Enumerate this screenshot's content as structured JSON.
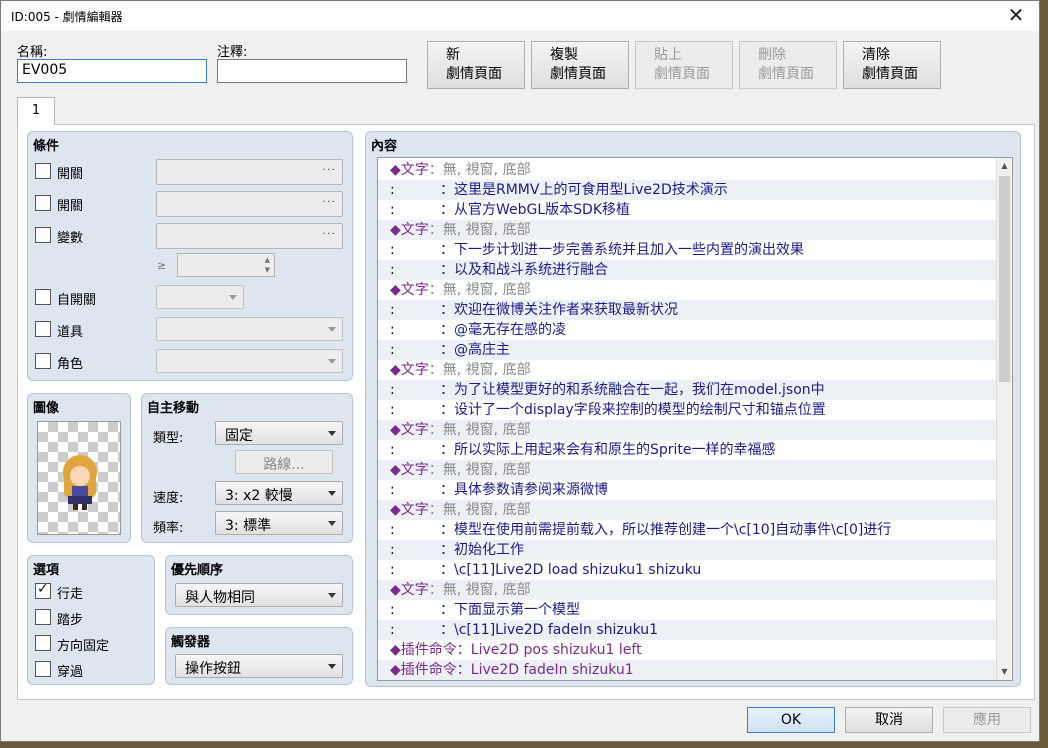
{
  "window": {
    "title": "ID:005 - 劇情編輯器"
  },
  "header": {
    "name_label": "名稱:",
    "name_value": "EV005",
    "note_label": "注釋:",
    "note_value": ""
  },
  "pagebuttons": [
    {
      "line1": "新",
      "line2": "劇情頁面",
      "disabled": false
    },
    {
      "line1": "複製",
      "line2": "劇情頁面",
      "disabled": false
    },
    {
      "line1": "貼上",
      "line2": "劇情頁面",
      "disabled": true
    },
    {
      "line1": "刪除",
      "line2": "劇情頁面",
      "disabled": true
    },
    {
      "line1": "清除",
      "line2": "劇情頁面",
      "disabled": false
    }
  ],
  "tab": {
    "label": "1"
  },
  "conditions": {
    "title": "條件",
    "switch1": "開關",
    "switch2": "開關",
    "variable": "變數",
    "ge": "≥",
    "self_switch": "自開關",
    "item": "道具",
    "actor": "角色",
    "dots": "···"
  },
  "image": {
    "title": "圖像"
  },
  "autonomous": {
    "title": "自主移動",
    "type_label": "類型:",
    "type_value": "固定",
    "route_button": "路線...",
    "speed_label": "速度:",
    "speed_value": "3: x2 較慢",
    "freq_label": "頻率:",
    "freq_value": "3: 標準"
  },
  "options": {
    "title": "選項",
    "walking": "行走",
    "stepping": "踏步",
    "direction_fix": "方向固定",
    "through": "穿過"
  },
  "priority": {
    "title": "優先順序",
    "value": "與人物相同"
  },
  "trigger": {
    "title": "觸發器",
    "value": "操作按鈕"
  },
  "contents": {
    "title": "內容",
    "rows": [
      {
        "kind": "head",
        "a": "◆文字",
        "b": "：無, 視窗, 底部"
      },
      {
        "kind": "text",
        "text": "这里是RMMV上的可食用型Live2D技术演示"
      },
      {
        "kind": "text",
        "text": "从官方WebGL版本SDK移植"
      },
      {
        "kind": "head",
        "a": "◆文字",
        "b": "：無, 視窗, 底部"
      },
      {
        "kind": "text",
        "text": "下一步计划进一步完善系统并且加入一些内置的演出效果"
      },
      {
        "kind": "text",
        "text": "以及和战斗系统进行融合"
      },
      {
        "kind": "head",
        "a": "◆文字",
        "b": "：無, 視窗, 底部"
      },
      {
        "kind": "text",
        "text": "欢迎在微博关注作者来获取最新状况"
      },
      {
        "kind": "text",
        "text": "@毫无存在感的凌"
      },
      {
        "kind": "text",
        "text": "@高庄主"
      },
      {
        "kind": "head",
        "a": "◆文字",
        "b": "：無, 視窗, 底部"
      },
      {
        "kind": "text",
        "text": "为了让模型更好的和系统融合在一起，我们在model.json中"
      },
      {
        "kind": "text",
        "text": "设计了一个display字段来控制的模型的绘制尺寸和锚点位置"
      },
      {
        "kind": "head",
        "a": "◆文字",
        "b": "：無, 視窗, 底部"
      },
      {
        "kind": "text",
        "text": "所以实际上用起来会有和原生的Sprite一样的幸福感"
      },
      {
        "kind": "head",
        "a": "◆文字",
        "b": "：無, 視窗, 底部"
      },
      {
        "kind": "text",
        "text": "具体参数请参阅来源微博"
      },
      {
        "kind": "head",
        "a": "◆文字",
        "b": "：無, 視窗, 底部"
      },
      {
        "kind": "text",
        "text": "模型在使用前需提前载入，所以推荐创建一个\\c[10]自动事件\\c[0]进行"
      },
      {
        "kind": "text",
        "text": "初始化工作"
      },
      {
        "kind": "text",
        "text": "\\c[11]Live2D load shizuku1 shizuku"
      },
      {
        "kind": "head",
        "a": "◆文字",
        "b": "：無, 視窗, 底部"
      },
      {
        "kind": "text",
        "text": "下面显示第一个模型"
      },
      {
        "kind": "text",
        "text": "\\c[11]Live2D fadeIn shizuku1"
      },
      {
        "kind": "plugin",
        "a": "◆插件命令",
        "b": "：Live2D pos shizuku1 left"
      },
      {
        "kind": "plugin",
        "a": "◆插件命令",
        "b": "：Live2D fadeIn shizuku1"
      }
    ],
    "cont_mark": ":"
  },
  "footer": {
    "ok": "OK",
    "cancel": "取消",
    "apply": "應用"
  },
  "icons": {
    "close": "close-icon",
    "check": "check-icon",
    "scroll_up": "scroll-up-icon",
    "scroll_down": "scroll-down-icon"
  }
}
